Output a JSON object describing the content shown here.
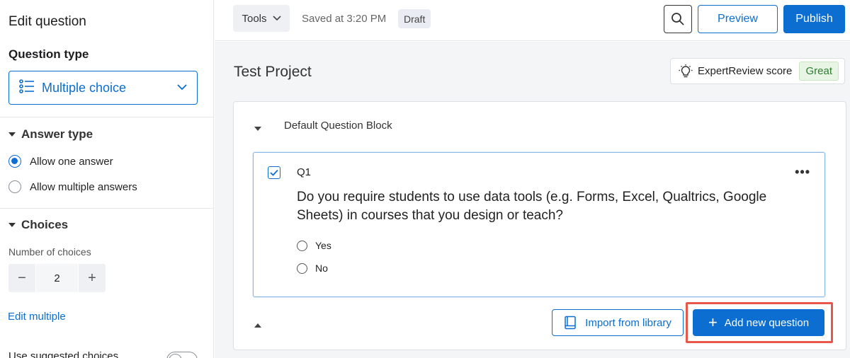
{
  "sidebar": {
    "title": "Edit question",
    "question_type_label": "Question type",
    "question_type_value": "Multiple choice",
    "answer_type_label": "Answer type",
    "answer_options": [
      "Allow one answer",
      "Allow multiple answers"
    ],
    "answer_selected": "Allow one answer",
    "choices_label": "Choices",
    "number_of_choices_label": "Number of choices",
    "number_of_choices": "2",
    "edit_multiple": "Edit multiple",
    "suggested_choices_label": "Use suggested choices"
  },
  "topbar": {
    "tools_label": "Tools",
    "saved_text": "Saved at 3:20 PM",
    "status_badge": "Draft",
    "preview_label": "Preview",
    "publish_label": "Publish"
  },
  "main": {
    "project_title": "Test Project",
    "expert_review_label": "ExpertReview score",
    "expert_review_score": "Great",
    "block_name": "Default Question Block",
    "question": {
      "number": "Q1",
      "text": "Do you require students to use data tools (e.g. Forms, Excel, Qualtrics, Google Sheets) in courses that you design or teach?",
      "choices": [
        "Yes",
        "No"
      ]
    },
    "import_label": "Import from library",
    "add_question_label": "Add new question"
  },
  "colors": {
    "accent": "#0b6ed0",
    "highlight": "#e8584a",
    "great_text": "#2e7d32"
  }
}
